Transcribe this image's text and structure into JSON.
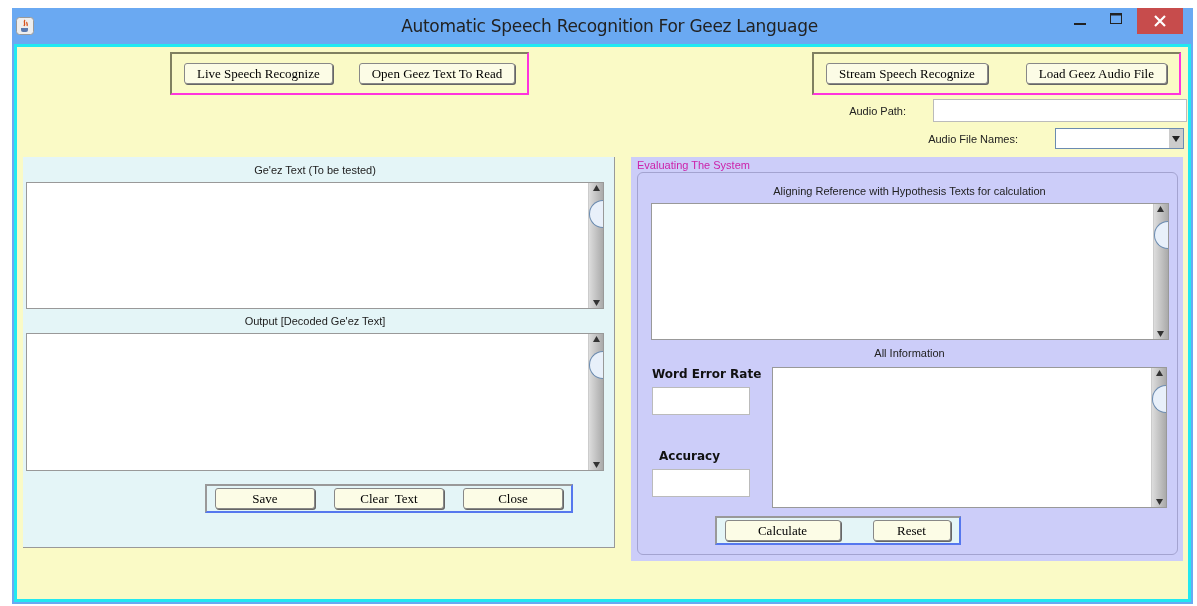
{
  "window": {
    "title": "Automatic Speech Recognition For Geez Language"
  },
  "top_buttons_left": [
    "Live Speech Recognize",
    "Open Geez Text To Read"
  ],
  "top_buttons_right": [
    "Stream Speech Recognize",
    "Load Geez Audio File"
  ],
  "audio_path": {
    "label": "Audio Path:"
  },
  "audio_file_names": {
    "label": "Audio File Names:"
  },
  "left_panel": {
    "input_label": "Ge'ez Text (To be tested)",
    "output_label": "Output [Decoded Ge'ez Text]",
    "buttons": [
      "Save",
      "Clear  Text",
      "Close"
    ]
  },
  "evaluation": {
    "title": "Evaluating The System",
    "alignment_label": "Aligning Reference with Hypothesis Texts for calculation",
    "info_label": "All Information",
    "wer_label": "Word Error Rate",
    "accuracy_label": "Accuracy",
    "buttons": [
      "Calculate",
      "Reset"
    ]
  }
}
